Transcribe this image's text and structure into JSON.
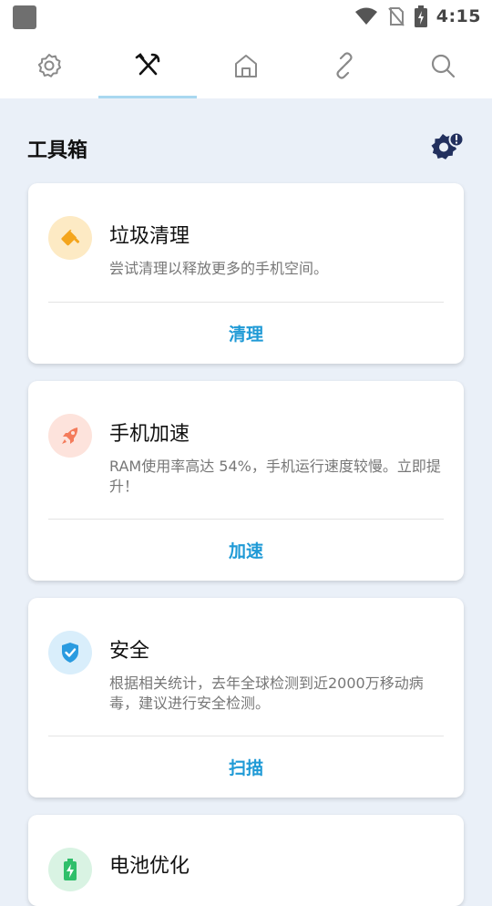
{
  "status_bar": {
    "time": "4:15",
    "icons": [
      "app-notification-icon",
      "wifi-icon",
      "no-sim-icon",
      "battery-charging-icon"
    ]
  },
  "tabs": [
    {
      "name": "settings",
      "icon": "gear-icon"
    },
    {
      "name": "toolbox",
      "icon": "tools-icon",
      "active": true
    },
    {
      "name": "home",
      "icon": "home-icon"
    },
    {
      "name": "links",
      "icon": "link-icon"
    },
    {
      "name": "search",
      "icon": "search-icon"
    }
  ],
  "header": {
    "title": "工具箱",
    "settings_icon": "gear-alert-icon"
  },
  "cards": [
    {
      "icon": "broom-icon",
      "title": "垃圾清理",
      "desc": "尝试清理以释放更多的手机空间。",
      "action": "清理"
    },
    {
      "icon": "rocket-icon",
      "title": "手机加速",
      "desc": "RAM使用率高达 54%，手机运行速度较慢。立即提升！",
      "action": "加速"
    },
    {
      "icon": "shield-check-icon",
      "title": "安全",
      "desc": "根据相关统计，去年全球检测到近2000万移动病毒，建议进行安全检测。",
      "action": "扫描"
    },
    {
      "icon": "battery-bolt-icon",
      "title": "电池优化"
    }
  ],
  "colors": {
    "accent": "#1f9ad6",
    "background": "#eaf0f8",
    "tab_indicator": "#a9d8f0",
    "junk_icon_bg": "#fdeac4",
    "junk_icon_fg": "#f4a51c",
    "boost_icon_bg": "#fde3dc",
    "boost_icon_fg": "#f47b5b",
    "security_icon_bg": "#d9eefb",
    "security_icon_fg": "#2a9be0",
    "battery_icon_bg": "#d9f3e3",
    "battery_icon_fg": "#2fbf6a"
  }
}
